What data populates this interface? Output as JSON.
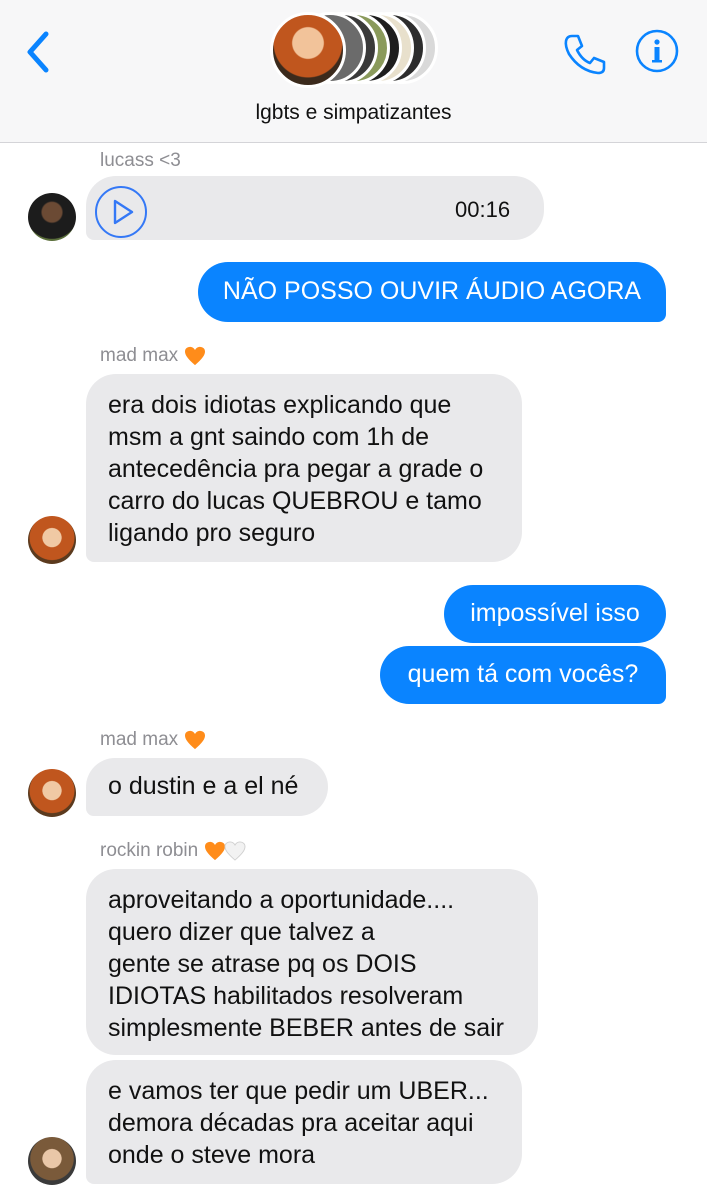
{
  "header": {
    "group_name": "lgbts e simpatizantes"
  },
  "messages": [
    {
      "sender": "lucass <3",
      "audio_duration": "00:16"
    },
    {
      "text": "NÃO POSSO OUVIR ÁUDIO AGORA"
    },
    {
      "sender": "mad max",
      "text": "era dois idiotas explicando que\nmsm a gnt saindo com 1h de\nantecedência pra pegar a grade o\ncarro do lucas QUEBROU e tamo\nligando pro seguro"
    },
    {
      "text": "impossível isso"
    },
    {
      "text": "quem tá com vocês?"
    },
    {
      "sender": "mad max",
      "text": "o dustin e a el né"
    },
    {
      "sender": "rockin robin",
      "text": "aproveitando a oportunidade....\nquero dizer que talvez a\ngente se atrase pq os DOIS\nIDIOTAS habilitados resolveram\nsimplesmente BEBER antes de sair"
    },
    {
      "text": "e vamos ter que pedir um UBER...\ndemora décadas pra aceitar aqui\nonde o steve mora"
    }
  ],
  "colors": {
    "accent": "#0a84ff",
    "incoming_bubble": "#e9e9eb",
    "heart_orange": "#ff8c1a",
    "heart_white": "#f2f2f2"
  },
  "icons": [
    "back-chevron-icon",
    "phone-icon",
    "info-icon",
    "play-icon",
    "orange-heart-icon",
    "white-heart-icon"
  ]
}
